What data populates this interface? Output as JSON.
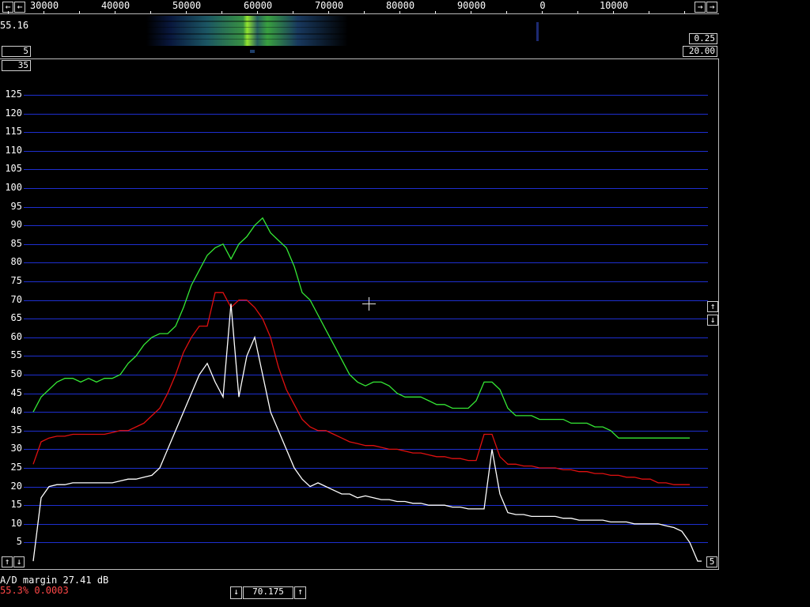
{
  "colors": {
    "grid": "#1e2fd0",
    "average_trace": "#35e835",
    "peak_trace": "#e01010",
    "spectrum_trace": "#ffffff",
    "status_red": "#ff4747"
  },
  "frequency_axis": [
    "30000",
    "40000",
    "50000",
    "60000",
    "70000",
    "80000",
    "90000",
    "0",
    "10000"
  ],
  "waterfall": {
    "value_label": "55.16",
    "left_box": "5",
    "top_right_box": "0.25",
    "bottom_right_box": "20.00"
  },
  "controls": {
    "scale_box": "35",
    "bottom_right_box": "5",
    "center_value": "70.175"
  },
  "icons": {
    "scroll_left": "left-arrow-icon",
    "scroll_right": "right-arrow-icon",
    "up": "up-arrow-icon",
    "down": "down-arrow-icon",
    "cursor": "crosshair-icon"
  },
  "status": {
    "ad_margin": "A/D margin 27.41 dB",
    "sample_info": "55.3% 0.0003"
  },
  "y_axis": {
    "ticks": [
      5,
      10,
      15,
      20,
      25,
      30,
      35,
      40,
      45,
      50,
      55,
      60,
      65,
      70,
      75,
      80,
      85,
      90,
      95,
      100,
      105,
      110,
      115,
      120,
      125
    ]
  },
  "chart_data": {
    "type": "line",
    "ylim": [
      0,
      130
    ],
    "grid": true,
    "x_tick_labels": [
      "30000",
      "40000",
      "50000",
      "60000",
      "70000",
      "80000",
      "90000",
      "0",
      "10000"
    ],
    "series": [
      {
        "color": "#35e835",
        "x": [
          0,
          10,
          20,
          30,
          40,
          50,
          60,
          70,
          80,
          90,
          100,
          110,
          120,
          130,
          140,
          150,
          160,
          170,
          180,
          190,
          200,
          210,
          220,
          230,
          240,
          250,
          260,
          270,
          280,
          290,
          300,
          310,
          320,
          330,
          340,
          350,
          360,
          370,
          380,
          390,
          400,
          410,
          420,
          430,
          440,
          450,
          460,
          470,
          480,
          490,
          500,
          510,
          520,
          530,
          540,
          550,
          560,
          570,
          580,
          590,
          600,
          610,
          620,
          630,
          640,
          650,
          660,
          670,
          680,
          690,
          700,
          710,
          720,
          730,
          740,
          750,
          760,
          770,
          780,
          790,
          800,
          810,
          820,
          830
        ],
        "y": [
          40,
          44,
          46,
          48,
          49,
          49,
          48,
          49,
          48,
          49,
          49,
          50,
          53,
          55,
          58,
          60,
          61,
          61,
          63,
          68,
          74,
          78,
          82,
          84,
          85,
          81,
          85,
          87,
          90,
          92,
          88,
          86,
          84,
          79,
          72,
          70,
          66,
          62,
          58,
          54,
          50,
          48,
          47,
          48,
          48,
          47,
          45,
          44,
          44,
          44,
          43,
          42,
          42,
          41,
          41,
          41,
          43,
          48,
          48,
          46,
          41,
          39,
          39,
          39,
          38,
          38,
          38,
          38,
          37,
          37,
          37,
          36,
          36,
          35,
          33,
          33,
          33,
          33,
          33,
          33,
          33,
          33,
          33,
          33
        ]
      },
      {
        "color": "#e01010",
        "x": [
          0,
          10,
          20,
          30,
          40,
          50,
          60,
          70,
          80,
          90,
          100,
          110,
          120,
          130,
          140,
          150,
          160,
          170,
          180,
          190,
          200,
          210,
          220,
          230,
          240,
          250,
          260,
          270,
          280,
          290,
          300,
          310,
          320,
          330,
          340,
          350,
          360,
          370,
          380,
          390,
          400,
          410,
          420,
          430,
          440,
          450,
          460,
          470,
          480,
          490,
          500,
          510,
          520,
          530,
          540,
          550,
          560,
          570,
          580,
          590,
          600,
          610,
          620,
          630,
          640,
          650,
          660,
          670,
          680,
          690,
          700,
          710,
          720,
          730,
          740,
          750,
          760,
          770,
          780,
          790,
          800,
          810,
          820,
          830
        ],
        "y": [
          26,
          32,
          33,
          33.5,
          33.5,
          34,
          34,
          34,
          34,
          34,
          34.5,
          35,
          35,
          36,
          37,
          39,
          41,
          45,
          50,
          56,
          60,
          63,
          63,
          72,
          72,
          68,
          70,
          70,
          68,
          65,
          60,
          52,
          46,
          42,
          38,
          36,
          35,
          35,
          34,
          33,
          32,
          31.5,
          31,
          31,
          30.5,
          30,
          30,
          29.5,
          29,
          29,
          28.5,
          28,
          28,
          27.5,
          27.5,
          27,
          27,
          34,
          34,
          28,
          26,
          26,
          25.5,
          25.5,
          25,
          25,
          25,
          24.5,
          24.5,
          24,
          24,
          23.5,
          23.5,
          23,
          23,
          22.5,
          22.5,
          22,
          22,
          21,
          21,
          20.5,
          20.5,
          20.5
        ]
      },
      {
        "color": "#ffffff",
        "x": [
          0,
          10,
          20,
          30,
          40,
          50,
          60,
          70,
          80,
          90,
          100,
          110,
          120,
          130,
          140,
          150,
          160,
          170,
          180,
          190,
          200,
          210,
          220,
          230,
          240,
          250,
          260,
          270,
          280,
          290,
          300,
          310,
          320,
          330,
          340,
          350,
          360,
          370,
          380,
          390,
          400,
          410,
          420,
          430,
          440,
          450,
          460,
          470,
          480,
          490,
          500,
          510,
          520,
          530,
          540,
          550,
          560,
          570,
          580,
          590,
          600,
          610,
          620,
          630,
          640,
          650,
          660,
          670,
          680,
          690,
          700,
          710,
          720,
          730,
          740,
          750,
          760,
          770,
          780,
          790,
          800,
          810,
          820,
          830,
          840,
          845
        ],
        "y": [
          0,
          17,
          20,
          20.5,
          20.5,
          21,
          21,
          21,
          21,
          21,
          21,
          21.5,
          22,
          22,
          22.5,
          23,
          25,
          30,
          35,
          40,
          45,
          50,
          53,
          48,
          44,
          69,
          44,
          55,
          60,
          50,
          40,
          35,
          30,
          25,
          22,
          20,
          21,
          20,
          19,
          18,
          18,
          17,
          17.5,
          17,
          16.5,
          16.5,
          16,
          16,
          15.5,
          15.5,
          15,
          15,
          15,
          14.5,
          14.5,
          14,
          14,
          14,
          30,
          18,
          13,
          12.5,
          12.5,
          12,
          12,
          12,
          12,
          11.5,
          11.5,
          11,
          11,
          11,
          11,
          10.5,
          10.5,
          10.5,
          10,
          10,
          10,
          10,
          9.5,
          9,
          8,
          5,
          0,
          0
        ]
      }
    ]
  }
}
